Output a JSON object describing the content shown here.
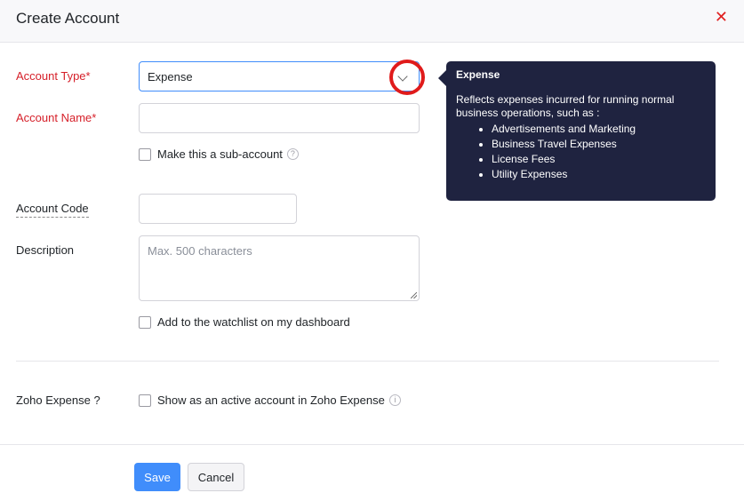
{
  "dialog": {
    "title": "Create Account",
    "close_icon": "close-icon"
  },
  "fields": {
    "account_type": {
      "label": "Account Type*",
      "value": "Expense"
    },
    "account_name": {
      "label": "Account Name*",
      "value": ""
    },
    "sub_account": {
      "label": "Make this a sub-account",
      "checked": false
    },
    "account_code": {
      "label": "Account Code",
      "value": ""
    },
    "description": {
      "label": "Description",
      "placeholder": "Max. 500 characters",
      "value": ""
    },
    "watchlist": {
      "label": "Add to the watchlist on my dashboard",
      "checked": false
    },
    "zoho_expense": {
      "label": "Zoho Expense ?",
      "option": "Show as an active account in Zoho Expense",
      "checked": false
    }
  },
  "tooltip": {
    "title": "Expense",
    "body": "Reflects expenses incurred for running normal business operations, such as :",
    "items": [
      "Advertisements and Marketing",
      "Business Travel Expenses",
      "License Fees",
      "Utility Expenses"
    ]
  },
  "buttons": {
    "save": "Save",
    "cancel": "Cancel"
  },
  "colors": {
    "primary": "#408dfb",
    "required": "#d6202a",
    "tooltip_bg": "#1f2340",
    "highlight": "#e01b1b"
  }
}
